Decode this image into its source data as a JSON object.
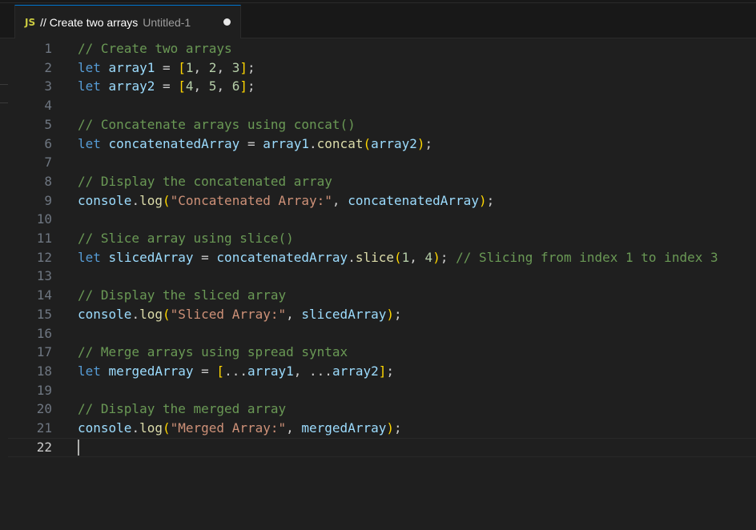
{
  "tab": {
    "icon_label": "JS",
    "title": "// Create two arrays",
    "description": "Untitled-1"
  },
  "editor": {
    "current_line": 22,
    "lines": [
      {
        "number": "1",
        "tokens": [
          {
            "t": "c",
            "v": "// Create two arrays"
          }
        ]
      },
      {
        "number": "2",
        "tokens": [
          {
            "t": "k",
            "v": "let"
          },
          {
            "t": "p",
            "v": " "
          },
          {
            "t": "v",
            "v": "array1"
          },
          {
            "t": "p",
            "v": " = "
          },
          {
            "t": "b1",
            "v": "["
          },
          {
            "t": "n",
            "v": "1"
          },
          {
            "t": "p",
            "v": ", "
          },
          {
            "t": "n",
            "v": "2"
          },
          {
            "t": "p",
            "v": ", "
          },
          {
            "t": "n",
            "v": "3"
          },
          {
            "t": "b1",
            "v": "]"
          },
          {
            "t": "p",
            "v": ";"
          }
        ]
      },
      {
        "number": "3",
        "tokens": [
          {
            "t": "k",
            "v": "let"
          },
          {
            "t": "p",
            "v": " "
          },
          {
            "t": "v",
            "v": "array2"
          },
          {
            "t": "p",
            "v": " = "
          },
          {
            "t": "b1",
            "v": "["
          },
          {
            "t": "n",
            "v": "4"
          },
          {
            "t": "p",
            "v": ", "
          },
          {
            "t": "n",
            "v": "5"
          },
          {
            "t": "p",
            "v": ", "
          },
          {
            "t": "n",
            "v": "6"
          },
          {
            "t": "b1",
            "v": "]"
          },
          {
            "t": "p",
            "v": ";"
          }
        ]
      },
      {
        "number": "4",
        "tokens": []
      },
      {
        "number": "5",
        "tokens": [
          {
            "t": "c",
            "v": "// Concatenate arrays using concat()"
          }
        ]
      },
      {
        "number": "6",
        "tokens": [
          {
            "t": "k",
            "v": "let"
          },
          {
            "t": "p",
            "v": " "
          },
          {
            "t": "v",
            "v": "concatenatedArray"
          },
          {
            "t": "p",
            "v": " = "
          },
          {
            "t": "v",
            "v": "array1"
          },
          {
            "t": "p",
            "v": "."
          },
          {
            "t": "f",
            "v": "concat"
          },
          {
            "t": "b1",
            "v": "("
          },
          {
            "t": "v",
            "v": "array2"
          },
          {
            "t": "b1",
            "v": ")"
          },
          {
            "t": "p",
            "v": ";"
          }
        ]
      },
      {
        "number": "7",
        "tokens": []
      },
      {
        "number": "8",
        "tokens": [
          {
            "t": "c",
            "v": "// Display the concatenated array"
          }
        ]
      },
      {
        "number": "9",
        "tokens": [
          {
            "t": "v",
            "v": "console"
          },
          {
            "t": "p",
            "v": "."
          },
          {
            "t": "f",
            "v": "log"
          },
          {
            "t": "b1",
            "v": "("
          },
          {
            "t": "s",
            "v": "\"Concatenated Array:\""
          },
          {
            "t": "p",
            "v": ", "
          },
          {
            "t": "v",
            "v": "concatenatedArray"
          },
          {
            "t": "b1",
            "v": ")"
          },
          {
            "t": "p",
            "v": ";"
          }
        ]
      },
      {
        "number": "10",
        "tokens": []
      },
      {
        "number": "11",
        "tokens": [
          {
            "t": "c",
            "v": "// Slice array using slice()"
          }
        ]
      },
      {
        "number": "12",
        "tokens": [
          {
            "t": "k",
            "v": "let"
          },
          {
            "t": "p",
            "v": " "
          },
          {
            "t": "v",
            "v": "slicedArray"
          },
          {
            "t": "p",
            "v": " = "
          },
          {
            "t": "v",
            "v": "concatenatedArray"
          },
          {
            "t": "p",
            "v": "."
          },
          {
            "t": "f",
            "v": "slice"
          },
          {
            "t": "b1",
            "v": "("
          },
          {
            "t": "n",
            "v": "1"
          },
          {
            "t": "p",
            "v": ", "
          },
          {
            "t": "n",
            "v": "4"
          },
          {
            "t": "b1",
            "v": ")"
          },
          {
            "t": "p",
            "v": "; "
          },
          {
            "t": "c",
            "v": "// Slicing from index 1 to index 3"
          }
        ]
      },
      {
        "number": "13",
        "tokens": []
      },
      {
        "number": "14",
        "tokens": [
          {
            "t": "c",
            "v": "// Display the sliced array"
          }
        ]
      },
      {
        "number": "15",
        "tokens": [
          {
            "t": "v",
            "v": "console"
          },
          {
            "t": "p",
            "v": "."
          },
          {
            "t": "f",
            "v": "log"
          },
          {
            "t": "b1",
            "v": "("
          },
          {
            "t": "s",
            "v": "\"Sliced Array:\""
          },
          {
            "t": "p",
            "v": ", "
          },
          {
            "t": "v",
            "v": "slicedArray"
          },
          {
            "t": "b1",
            "v": ")"
          },
          {
            "t": "p",
            "v": ";"
          }
        ]
      },
      {
        "number": "16",
        "tokens": []
      },
      {
        "number": "17",
        "tokens": [
          {
            "t": "c",
            "v": "// Merge arrays using spread syntax"
          }
        ]
      },
      {
        "number": "18",
        "tokens": [
          {
            "t": "k",
            "v": "let"
          },
          {
            "t": "p",
            "v": " "
          },
          {
            "t": "v",
            "v": "mergedArray"
          },
          {
            "t": "p",
            "v": " = "
          },
          {
            "t": "b1",
            "v": "["
          },
          {
            "t": "p",
            "v": "..."
          },
          {
            "t": "v",
            "v": "array1"
          },
          {
            "t": "p",
            "v": ", ..."
          },
          {
            "t": "v",
            "v": "array2"
          },
          {
            "t": "b1",
            "v": "]"
          },
          {
            "t": "p",
            "v": ";"
          }
        ]
      },
      {
        "number": "19",
        "tokens": []
      },
      {
        "number": "20",
        "tokens": [
          {
            "t": "c",
            "v": "// Display the merged array"
          }
        ]
      },
      {
        "number": "21",
        "tokens": [
          {
            "t": "v",
            "v": "console"
          },
          {
            "t": "p",
            "v": "."
          },
          {
            "t": "f",
            "v": "log"
          },
          {
            "t": "b1",
            "v": "("
          },
          {
            "t": "s",
            "v": "\"Merged Array:\""
          },
          {
            "t": "p",
            "v": ", "
          },
          {
            "t": "v",
            "v": "mergedArray"
          },
          {
            "t": "b1",
            "v": ")"
          },
          {
            "t": "p",
            "v": ";"
          }
        ]
      },
      {
        "number": "22",
        "tokens": []
      }
    ]
  }
}
